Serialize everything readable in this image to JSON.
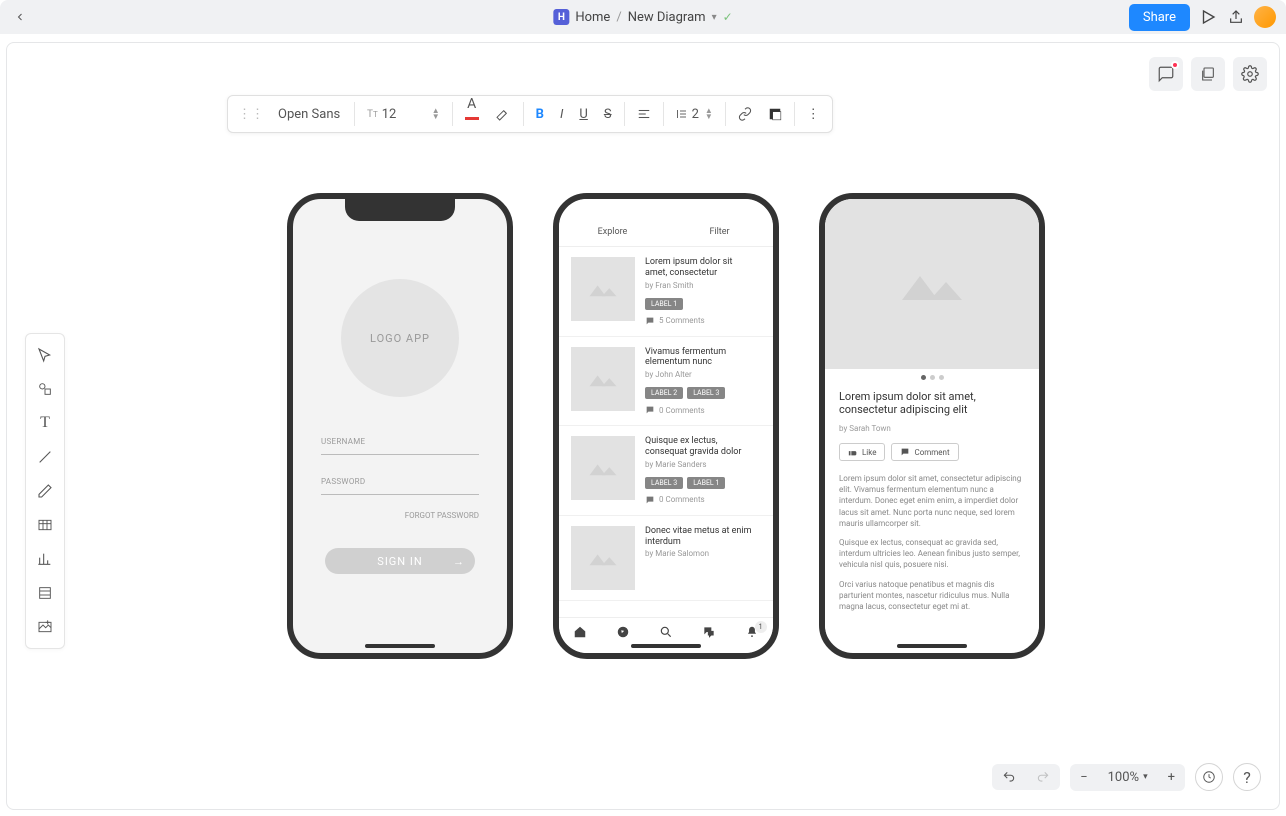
{
  "breadcrumb": {
    "home": "Home",
    "doc": "New Diagram"
  },
  "share": "Share",
  "toolbar": {
    "font": "Open Sans",
    "size": "12",
    "lineheight": "2"
  },
  "zoom": "100%",
  "mock1": {
    "logo": "LOGO APP",
    "username": "USERNAME",
    "password": "PASSWORD",
    "forgot": "FORGOT PASSWORD",
    "signin": "SIGN IN"
  },
  "mock2": {
    "tab_explore": "Explore",
    "tab_filter": "Filter",
    "items": [
      {
        "title": "Lorem ipsum dolor sit amet, consectetur",
        "author": "by Fran Smith",
        "tags": [
          "LABEL 1"
        ],
        "comments": "5 Comments"
      },
      {
        "title": "Vivamus fermentum elementum nunc",
        "author": "by John Alter",
        "tags": [
          "LABEL 2",
          "LABEL 3"
        ],
        "comments": "0 Comments"
      },
      {
        "title": "Quisque ex lectus, consequat gravida dolor",
        "author": "by Marie Sanders",
        "tags": [
          "LABEL 3",
          "LABEL 1"
        ],
        "comments": "0 Comments"
      },
      {
        "title": "Donec vitae metus at enim interdum",
        "author": "by Marie Salomon",
        "tags": [],
        "comments": ""
      }
    ],
    "nav_badge": "1"
  },
  "mock3": {
    "title": "Lorem ipsum dolor sit amet, consectetur adipiscing elit",
    "author": "by Sarah Town",
    "like": "Like",
    "comment": "Comment",
    "p1": "Lorem ipsum dolor sit amet, consectetur adipiscing elit. Vivamus fermentum elementum nunc a interdum. Donec eget enim enim, a imperdiet dolor lacus sit amet. Nunc porta nunc neque, sed lorem mauris ullamcorper sit.",
    "p2": "Quisque ex lectus, consequat ac gravida sed, interdum ultricies leo. Aenean finibus justo semper, vehicula nisl quis, posuere nisi.",
    "p3": "Orci varius natoque penatibus et magnis dis parturient montes, nascetur ridiculus mus. Nulla magna lacus, consectetur eget mi at."
  }
}
